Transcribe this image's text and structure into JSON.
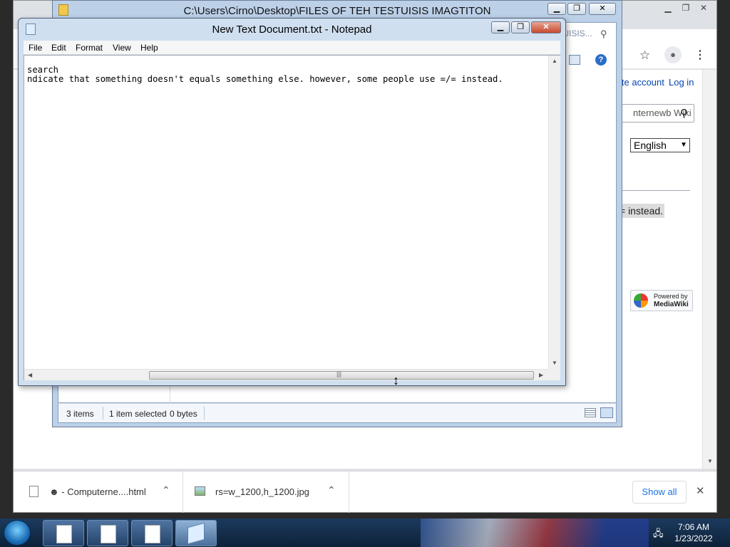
{
  "chrome": {
    "create_account": "ite account",
    "log_in": "Log in",
    "wiki_search_placeholder": "nternewb Wiki",
    "language_selected": "English",
    "highlight_text": "= instead.",
    "powered_by": "Powered by",
    "mediawiki": "MediaWiki",
    "partial_address": "UTESTUISIS..."
  },
  "downloads": {
    "items": [
      {
        "label": "☻ - Computerne....html"
      },
      {
        "label": "rs=w_1200,h_1200.jpg"
      }
    ],
    "show_all": "Show all",
    "close": "✕"
  },
  "explorer": {
    "title": "C:\\Users\\Cirno\\Desktop\\FILES OF TEH TESTUISIS IMAGTITON",
    "status_items": "3 items",
    "status_selected": "1 item selected",
    "status_size": "0 bytes"
  },
  "notepad": {
    "title": "New Text Document.txt - Notepad",
    "menu": [
      "File",
      "Edit",
      "Format",
      "View",
      "Help"
    ],
    "content_lines": [
      "search",
      "ndicate that something doesn't equals something else. however, some people use =/= instead."
    ]
  },
  "taskbar": {
    "time": "7:06 AM",
    "date": "1/23/2022"
  }
}
